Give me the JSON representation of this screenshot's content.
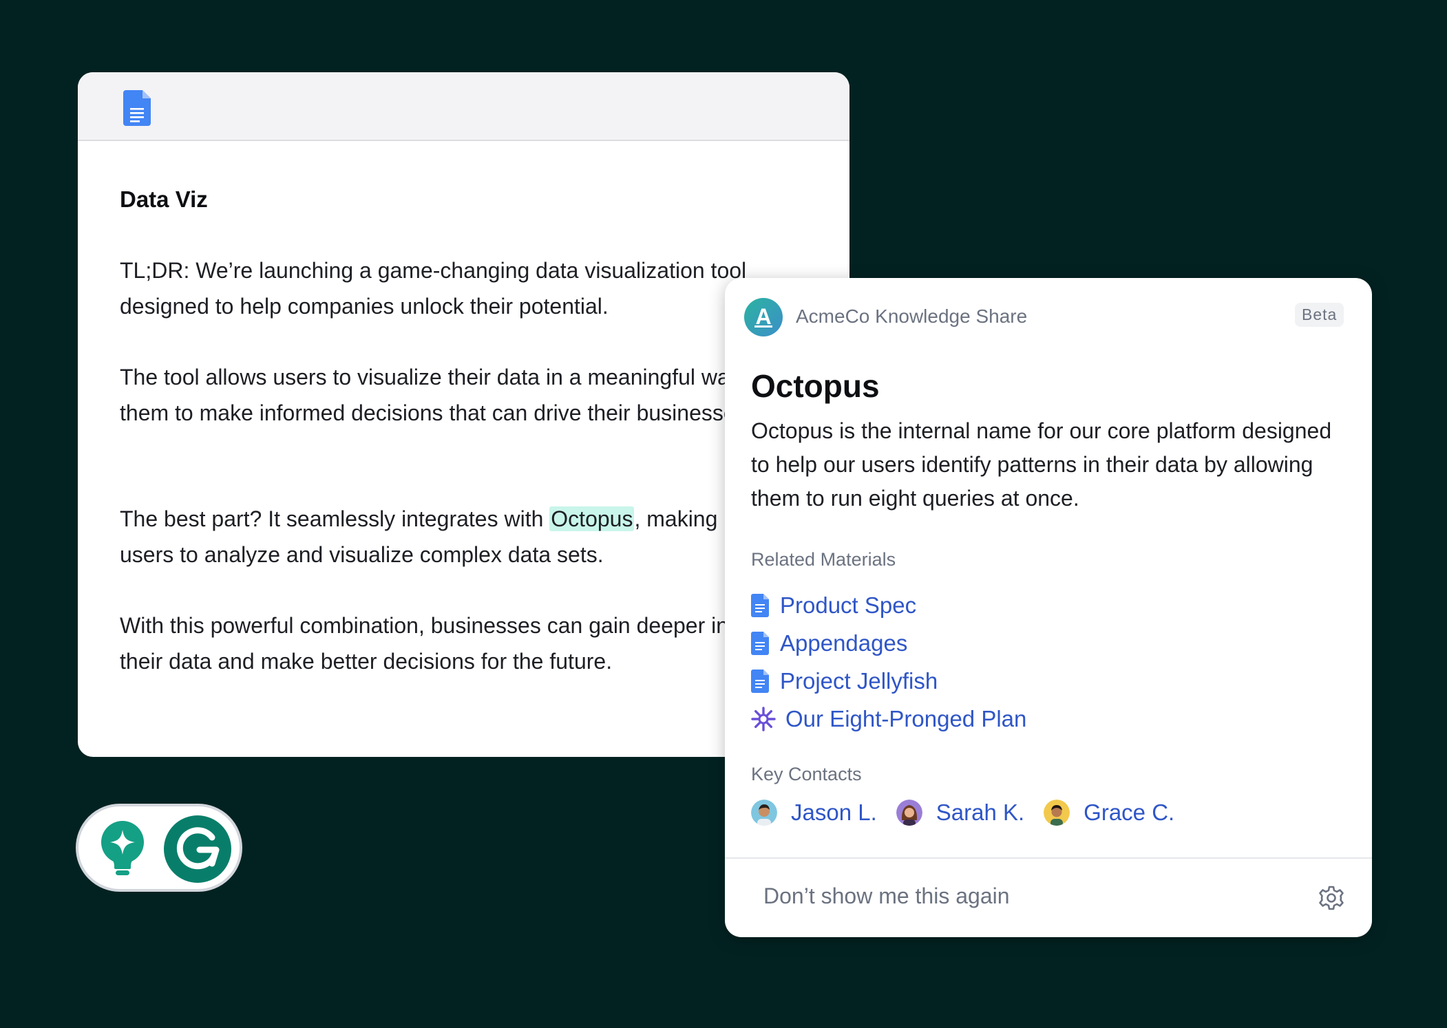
{
  "document": {
    "icon": "google-docs-icon",
    "title": "Data Viz",
    "paragraphs": {
      "p1": "TL;DR: We’re launching a game-changing data visualization tool designed to help companies unlock their potential.",
      "p2": "The tool allows users to visualize their data in a meaningful way, enabling them to make informed decisions that can drive their businesses forward.",
      "p3_before": "The best part? It seamlessly integrates with ",
      "p3_highlight": "Octopus",
      "p3_after": ", making it easy for users to analyze and visualize complex data sets.",
      "p4": "With this powerful combination, businesses can gain deeper insights into their data and make better decisions for the future."
    }
  },
  "grammarly": {
    "icons": [
      "lightbulb-sparkle-icon",
      "grammarly-logo-icon"
    ]
  },
  "card": {
    "brand_initial": "A",
    "brand_name": "AcmeCo Knowledge Share",
    "badge": "Beta",
    "title": "Octopus",
    "description": "Octopus is the internal name for our core platform designed to help our users identify patterns in their data by allowing them to run eight queries at once.",
    "related_label": "Related Materials",
    "materials": [
      {
        "label": "Product Spec",
        "icon": "google-docs-icon"
      },
      {
        "label": "Appendages",
        "icon": "google-docs-icon"
      },
      {
        "label": "Project Jellyfish",
        "icon": "google-docs-icon"
      },
      {
        "label": "Our Eight-Pronged Plan",
        "icon": "sparkle-burst-icon"
      }
    ],
    "contacts_label": "Key Contacts",
    "contacts": [
      {
        "name": "Jason L."
      },
      {
        "name": "Sarah K."
      },
      {
        "name": "Grace C."
      }
    ],
    "footer_dismiss": "Don’t show me this again",
    "footer_icon": "gear-icon"
  },
  "colors": {
    "background": "#022221",
    "link": "#2f56c7",
    "highlight": "#c9f5ea",
    "docs_blue": "#4285f4",
    "grammarly_green": "#087e6a"
  }
}
